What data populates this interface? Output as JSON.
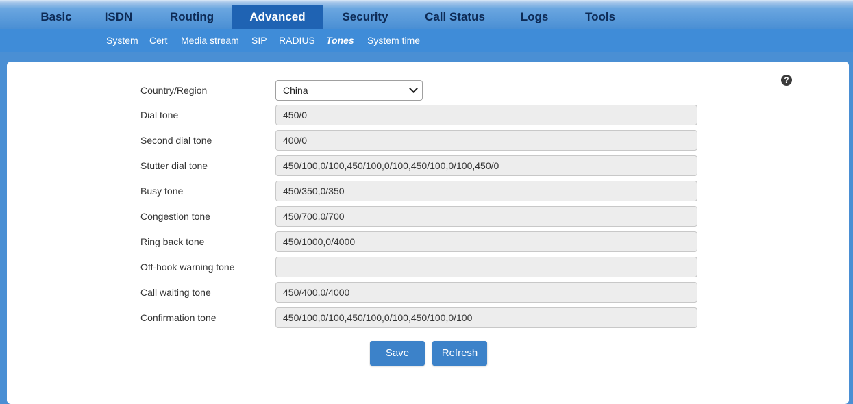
{
  "topnav": {
    "tabs": [
      {
        "label": "Basic"
      },
      {
        "label": "ISDN"
      },
      {
        "label": "Routing"
      },
      {
        "label": "Advanced"
      },
      {
        "label": "Security"
      },
      {
        "label": "Call Status"
      },
      {
        "label": "Logs"
      },
      {
        "label": "Tools"
      }
    ],
    "active": "Advanced"
  },
  "subnav": {
    "items": [
      {
        "label": "System"
      },
      {
        "label": "Cert"
      },
      {
        "label": "Media stream"
      },
      {
        "label": "SIP"
      },
      {
        "label": "RADIUS"
      },
      {
        "label": "Tones"
      },
      {
        "label": "System time"
      }
    ],
    "active": "Tones"
  },
  "help_icon": "question-circle-icon",
  "form": {
    "country": {
      "label": "Country/Region",
      "value": "China"
    },
    "rows": [
      {
        "label": "Dial tone",
        "value": "450/0"
      },
      {
        "label": "Second dial tone",
        "value": "400/0"
      },
      {
        "label": "Stutter dial tone",
        "value": "450/100,0/100,450/100,0/100,450/100,0/100,450/0"
      },
      {
        "label": "Busy tone",
        "value": "450/350,0/350"
      },
      {
        "label": "Congestion tone",
        "value": "450/700,0/700"
      },
      {
        "label": "Ring back tone",
        "value": "450/1000,0/4000"
      },
      {
        "label": "Off-hook warning tone",
        "value": ""
      },
      {
        "label": "Call waiting tone",
        "value": "450/400,0/4000"
      },
      {
        "label": "Confirmation tone",
        "value": "450/100,0/100,450/100,0/100,450/100,0/100"
      }
    ]
  },
  "buttons": {
    "save": "Save",
    "refresh": "Refresh"
  },
  "colors": {
    "nav_bg": "#4a8fd4",
    "active_tab": "#1f63b3",
    "button": "#3c82c9"
  }
}
